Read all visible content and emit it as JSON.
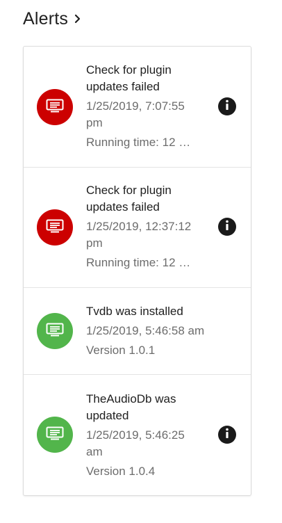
{
  "header": {
    "title": "Alerts",
    "chevron_icon": "chevron-right-icon"
  },
  "colors": {
    "error": "#cc0000",
    "success": "#52b54b",
    "info_button": "#1a1a1a"
  },
  "alerts": [
    {
      "title": "Check for plugin updates failed",
      "date": "1/25/2019, 7:07:55 pm",
      "subtitle": "Running time: 12 …",
      "status": "error",
      "icon": "notification-icon",
      "has_info": true
    },
    {
      "title": "Check for plugin updates failed",
      "date": "1/25/2019, 12:37:12 pm",
      "subtitle": "Running time: 12 …",
      "status": "error",
      "icon": "notification-icon",
      "has_info": true
    },
    {
      "title": "Tvdb was installed",
      "date": "1/25/2019, 5:46:58 am",
      "subtitle": "Version 1.0.1",
      "status": "success",
      "icon": "notification-icon",
      "has_info": false
    },
    {
      "title": "TheAudioDb was updated",
      "date": "1/25/2019, 5:46:25 am",
      "subtitle": "Version 1.0.4",
      "status": "success",
      "icon": "notification-icon",
      "has_info": true
    }
  ]
}
